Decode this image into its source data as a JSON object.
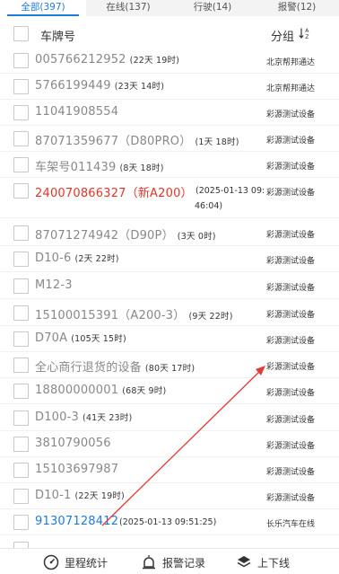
{
  "tabs": [
    {
      "label": "全部(397)"
    },
    {
      "label": "在线(137)"
    },
    {
      "label": "行驶(14)"
    },
    {
      "label": "报警(12)"
    }
  ],
  "header": {
    "plate_col": "车牌号",
    "group_col": "分组"
  },
  "rows": [
    {
      "plate": "005766212952",
      "dur": "(22天 19时)",
      "group": "北京帮邦通达"
    },
    {
      "plate": "5766199449",
      "dur": "(23天 14时)",
      "group": "北京帮邦通达"
    },
    {
      "plate": "11041908554",
      "dur": "",
      "group": "彩源测试设备"
    },
    {
      "plate": "87071359677（D80PRO）",
      "dur": "(1天 18时)",
      "group": "彩源测试设备"
    },
    {
      "plate": "车架号011439",
      "dur": "(8天 18时)",
      "group": "彩源测试设备"
    },
    {
      "plate": "240070866327（新A200）",
      "time1": "(2025-01-13 09:",
      "time2": "46:04)",
      "group": "彩源测试设备"
    },
    {
      "plate": "87071274942（D90P）",
      "dur": "(3天 0时)",
      "group": "彩源测试设备"
    },
    {
      "plate": "D10-6",
      "dur": "(2天 22时)",
      "group": "彩源测试设备"
    },
    {
      "plate": "M12-3",
      "dur": "",
      "group": "彩源测试设备"
    },
    {
      "plate": "15100015391（A200-3）",
      "dur": "(9天 22时)",
      "group": "彩源测试设备"
    },
    {
      "plate": "D70A",
      "dur": "(105天 15时)",
      "group": "彩源测试设备"
    },
    {
      "plate": "全心商行退货的设备",
      "dur": "(80天 17时)",
      "group": "彩源测试设备"
    },
    {
      "plate": "18800000001",
      "dur": "(68天 9时)",
      "group": "彩源测试设备"
    },
    {
      "plate": "D100-3",
      "dur": "(41天 23时)",
      "group": "彩源测试设备"
    },
    {
      "plate": "3810790056",
      "dur": "",
      "group": "彩源测试设备"
    },
    {
      "plate": "15103697987",
      "dur": "",
      "group": "彩源测试设备"
    },
    {
      "plate": "D10-1",
      "dur": "(22天 19时)",
      "group": "彩源测试设备"
    },
    {
      "plate": "91307128412",
      "time": "(2025-01-13 09:51:25)",
      "group": "长乐汽车在线"
    }
  ],
  "footer": {
    "mileage": "里程统计",
    "alarm_log": "报警记录",
    "online_offline": "上下线"
  },
  "colors": {
    "accent": "#1f7bd8",
    "alarm": "#e2332a",
    "annotation_arrow": "#e53935"
  }
}
